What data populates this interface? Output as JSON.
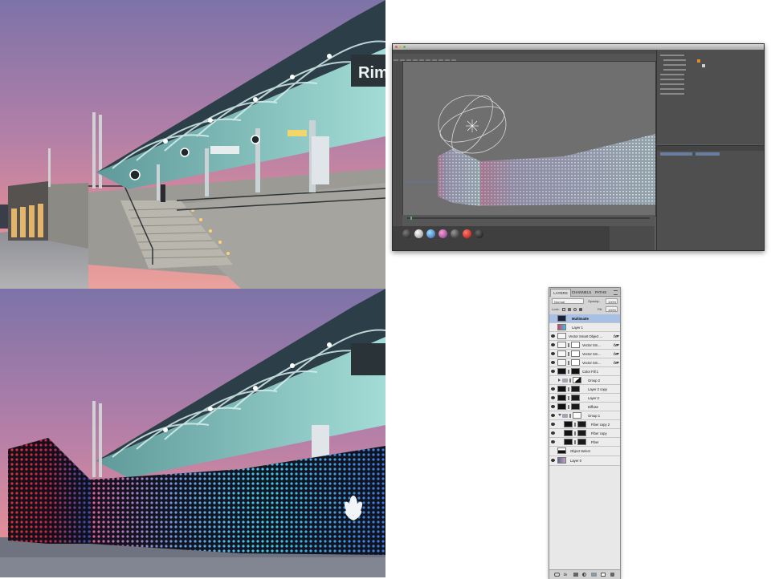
{
  "photo_before": {
    "sign_text": "Rimi",
    "colors": {
      "sky_top": "#8a76ac",
      "sky_bottom": "#d98b98",
      "canopy": "#8fd3cf",
      "concrete": "#9a9a94"
    }
  },
  "photo_after": {
    "colors": {
      "led_red": "#d8323c",
      "led_pink": "#e05fa0",
      "led_cyan": "#45c8e8",
      "led_blue": "#3f78d8"
    }
  },
  "c4d": {
    "window_title": ""
  },
  "ps": {
    "tabs": [
      "LAYERS",
      "CHANNELS",
      "PATHS"
    ],
    "active_tab": "LAYERS",
    "blend_mode": "Normal",
    "opacity_label": "Opacity:",
    "opacity_value": "100%",
    "lock_label": "Lock:",
    "fill_label": "Fill:",
    "fill_value": "100%",
    "layers": [
      {
        "name": "Multimatte",
        "selected": true
      },
      {
        "name": "Layer 1"
      },
      {
        "name": "Vector Smart Object ...",
        "fx": "fx"
      },
      {
        "name": "Vector Sm...",
        "fx": "fx"
      },
      {
        "name": "Vector Sm...",
        "fx": "fx"
      },
      {
        "name": "Vector Sm...",
        "fx": "fx"
      },
      {
        "name": "Color Fill 1"
      },
      {
        "name": "Group 2"
      },
      {
        "name": "Layer 2 copy"
      },
      {
        "name": "Layer 2"
      },
      {
        "name": "Diffuse"
      },
      {
        "name": "Group 1"
      },
      {
        "name": "Fiber copy 2"
      },
      {
        "name": "Fiber copy"
      },
      {
        "name": "Fiber"
      },
      {
        "name": "Object Select"
      },
      {
        "name": "Layer 0"
      }
    ],
    "bottom_icons": [
      "link-icon",
      "fx-icon",
      "mask-icon",
      "adjustment-icon",
      "folder-icon",
      "new-layer-icon",
      "trash-icon"
    ]
  }
}
